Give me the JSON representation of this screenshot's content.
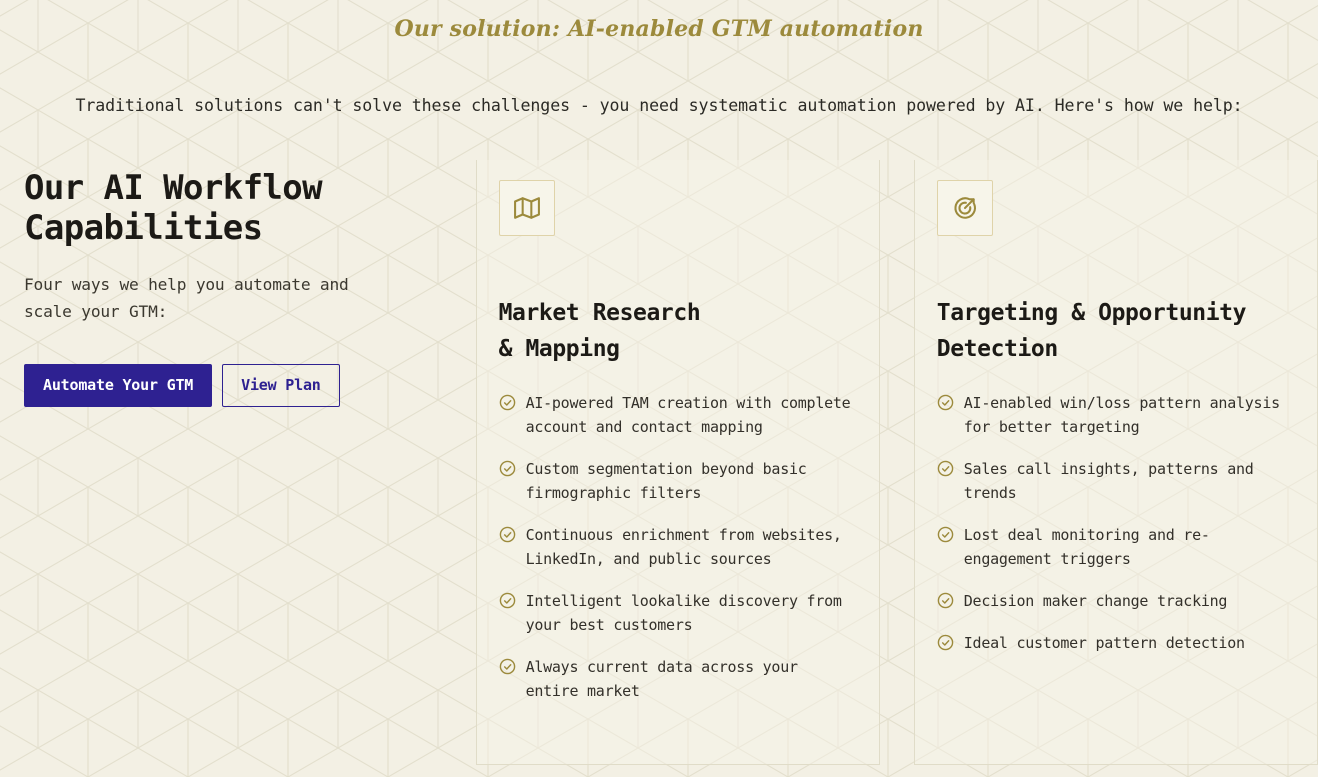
{
  "header": {
    "eyebrow": "Our solution: AI-enabled GTM automation",
    "intro": "Traditional solutions can't solve these challenges - you need systematic automation powered by AI. Here's how we help:"
  },
  "intro_column": {
    "title": "Our AI Workflow Capabilities",
    "subtitle": "Four ways we help you automate and scale your GTM:",
    "primary_button": "Automate Your GTM",
    "secondary_button": "View Plan"
  },
  "cards": [
    {
      "icon": "map-icon",
      "title": "Market Research\n& Mapping",
      "items": [
        "AI-powered TAM creation with complete account and contact mapping",
        "Custom segmentation beyond basic firmographic filters",
        "Continuous enrichment from websites, LinkedIn, and public sources",
        "Intelligent lookalike discovery from your best customers",
        "Always current data across your entire market"
      ]
    },
    {
      "icon": "target-arrow-icon",
      "title": "Targeting & Opportunity\nDetection",
      "items": [
        "AI-enabled win/loss pattern analysis for better targeting",
        "Sales call insights, patterns and trends",
        "Lost deal monitoring and re-engagement triggers",
        "Decision maker change tracking",
        "Ideal customer pattern detection"
      ]
    }
  ],
  "colors": {
    "background": "#F3F0E4",
    "pattern_line": "#E3DFCD",
    "gold": "#9C8A3C",
    "indigo": "#2E2191",
    "text": "#1C1A16",
    "card_border": "#E0DCC8",
    "icon_box_border": "#DFD3A9"
  }
}
